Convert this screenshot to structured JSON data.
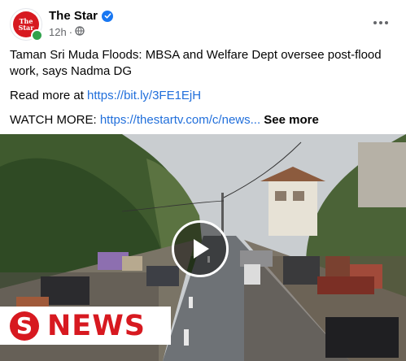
{
  "post": {
    "page_name": "The Star",
    "time": "12h",
    "separator": "·",
    "avatar_text": "TheStar"
  },
  "content": {
    "headline": "Taman Sri Muda Floods: MBSA and Welfare Dept oversee post-flood work, says Nadma DG",
    "read_more_label": "Read more at ",
    "read_more_link": "https://bit.ly/3FE1EjH",
    "watch_more_label": "WATCH MORE: ",
    "watch_more_link": "https://thestartv.com/c/news...",
    "see_more": "See more"
  },
  "video": {
    "logo_letter": "S",
    "logo_text": "NEWS"
  },
  "colors": {
    "brand_red": "#d71920",
    "link_blue": "#216fdb",
    "verified_blue": "#1877f2",
    "online_green": "#31a24c",
    "meta_gray": "#65676b"
  },
  "icons": {
    "verified": "verified-badge-icon",
    "privacy": "globe-icon",
    "more": "more-options-icon",
    "play": "play-icon"
  }
}
